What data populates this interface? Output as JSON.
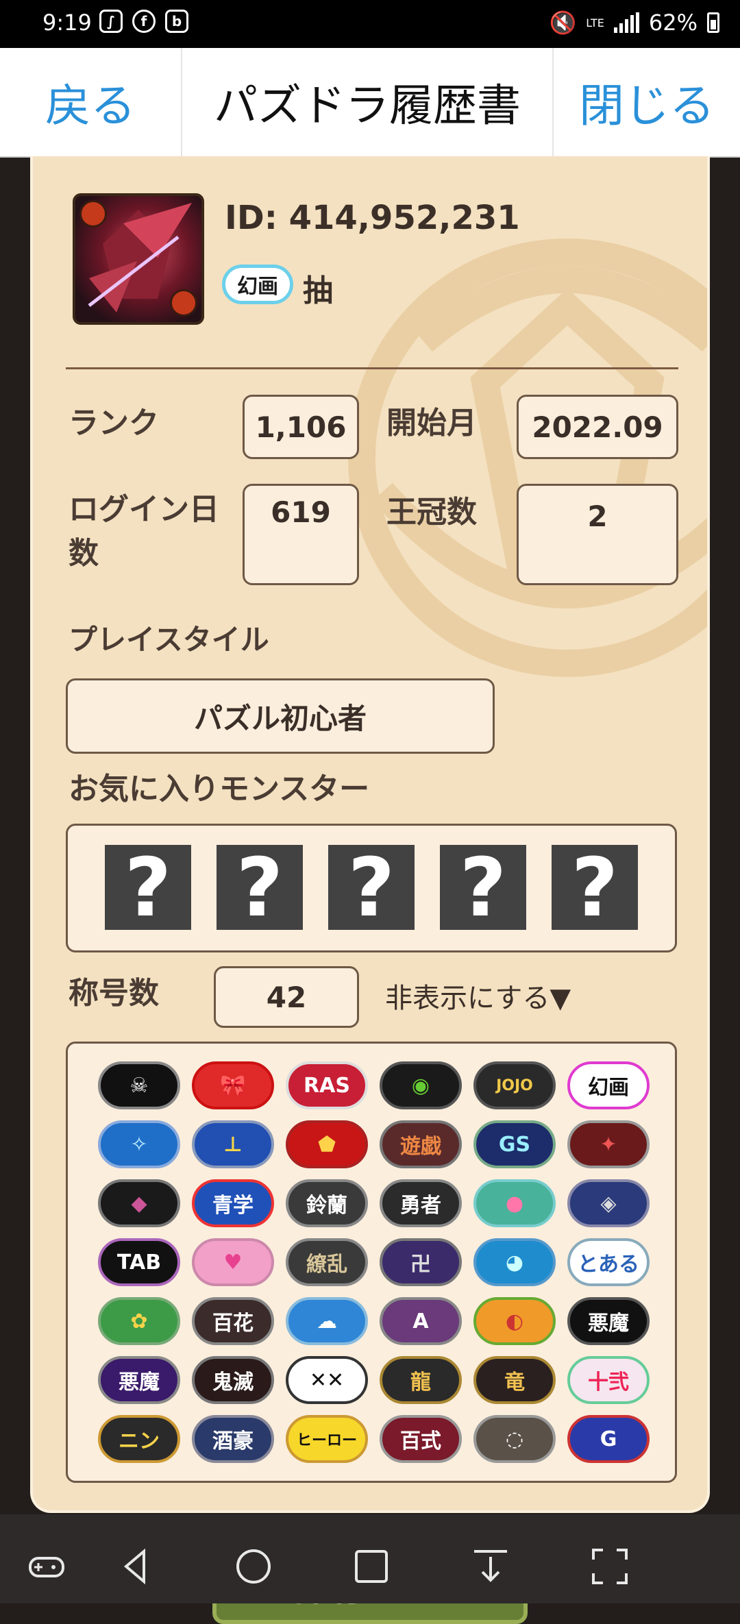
{
  "status": {
    "time": "9:19",
    "network": "LTE",
    "battery": "62%"
  },
  "header": {
    "back": "戻る",
    "title": "パズドラ履歴書",
    "close": "閉じる"
  },
  "profile": {
    "id_text": "ID: 414,952,231",
    "badge": "幻画",
    "name": "抽",
    "rank_label": "ランク",
    "rank": "1,106",
    "start_label": "開始月",
    "start": "2022.09",
    "login_label": "ログイン日\n数",
    "login": "619",
    "crown_label": "王冠数",
    "crown": "2",
    "style_label": "プレイスタイル",
    "style": "パズル初心者",
    "fav_label": "お気に入りモンスター",
    "fav": [
      "?",
      "?",
      "?",
      "?",
      "?"
    ],
    "titles_label": "称号数",
    "titles_count": "42",
    "toggle": "非表示にする▼"
  },
  "badges": [
    {
      "t": "☠",
      "bg": "#111",
      "fg": "#fff",
      "border": "#888"
    },
    {
      "t": "🎀",
      "bg": "#e02a2a",
      "fg": "#fff",
      "border": "#c11"
    },
    {
      "t": "RAS",
      "bg": "#c81f36",
      "fg": "#fff",
      "border": "#ddd"
    },
    {
      "t": "◉",
      "bg": "#1a1a1a",
      "fg": "#6c3",
      "border": "#555"
    },
    {
      "t": "JOJO",
      "bg": "#2a2a2a",
      "fg": "#f0c94a",
      "border": "#555"
    },
    {
      "t": "幻画",
      "bg": "#fff",
      "fg": "#111",
      "border": "#e03ad0"
    },
    {
      "t": "✧",
      "bg": "#1f6fc8",
      "fg": "#bfefff",
      "border": "#8ad"
    },
    {
      "t": "⊥",
      "bg": "#214fb2",
      "fg": "#f3d34a",
      "border": "#89b"
    },
    {
      "t": "⬟",
      "bg": "#c81616",
      "fg": "#ffd24a",
      "border": "#a22"
    },
    {
      "t": "遊戯",
      "bg": "#5a2a2a",
      "fg": "#e84",
      "border": "#777"
    },
    {
      "t": "GS",
      "bg": "#1d2c6b",
      "fg": "#9ef",
      "border": "#7a8"
    },
    {
      "t": "✦",
      "bg": "#6a1a1a",
      "fg": "#e55",
      "border": "#999"
    },
    {
      "t": "◆",
      "bg": "#1a1a1a",
      "fg": "#c59",
      "border": "#777"
    },
    {
      "t": "青学",
      "bg": "#2051b8",
      "fg": "#fff",
      "border": "#e33"
    },
    {
      "t": "鈴蘭",
      "bg": "#3a3a3a",
      "fg": "#fff",
      "border": "#888"
    },
    {
      "t": "勇者",
      "bg": "#2b2b2b",
      "fg": "#fff",
      "border": "#888"
    },
    {
      "t": "●",
      "bg": "#49b29a",
      "fg": "#f7a",
      "border": "#7cc"
    },
    {
      "t": "◈",
      "bg": "#2a3a7a",
      "fg": "#ddd",
      "border": "#88a"
    },
    {
      "t": "TAB",
      "bg": "#111",
      "fg": "#fff",
      "border": "#a6b"
    },
    {
      "t": "♥",
      "bg": "#f3a0c8",
      "fg": "#e7418f",
      "border": "#c8a"
    },
    {
      "t": "繚乱",
      "bg": "#3a3a3a",
      "fg": "#d9c79a",
      "border": "#888"
    },
    {
      "t": "卍",
      "bg": "#3b2b6b",
      "fg": "#ddd",
      "border": "#777"
    },
    {
      "t": "◕",
      "bg": "#1f8ccd",
      "fg": "#cff",
      "border": "#59c"
    },
    {
      "t": "とある",
      "bg": "#fff",
      "fg": "#2a62b8",
      "border": "#8ab"
    },
    {
      "t": "✿",
      "bg": "#3d9b48",
      "fg": "#f7d34a",
      "border": "#7a7"
    },
    {
      "t": "百花",
      "bg": "#3b2b2b",
      "fg": "#fff",
      "border": "#888"
    },
    {
      "t": "☁",
      "bg": "#2f86d6",
      "fg": "#fff",
      "border": "#8bd"
    },
    {
      "t": "A",
      "bg": "#6a3a7a",
      "fg": "#fff",
      "border": "#888"
    },
    {
      "t": "◐",
      "bg": "#f09a2a",
      "fg": "#c33",
      "border": "#6a3"
    },
    {
      "t": "悪魔",
      "bg": "#111",
      "fg": "#fff",
      "border": "#555"
    },
    {
      "t": "悪魔",
      "bg": "#3a1a6a",
      "fg": "#fff",
      "border": "#888"
    },
    {
      "t": "鬼滅",
      "bg": "#2a1a1a",
      "fg": "#fff",
      "border": "#777"
    },
    {
      "t": "✕✕",
      "bg": "#fff",
      "fg": "#111",
      "border": "#333"
    },
    {
      "t": "龍",
      "bg": "#2a2a2a",
      "fg": "#f0c050",
      "border": "#a83"
    },
    {
      "t": "竜",
      "bg": "#2a2020",
      "fg": "#f0c050",
      "border": "#a83"
    },
    {
      "t": "十弐",
      "bg": "#f6e6ef",
      "fg": "#e25",
      "border": "#6c9"
    },
    {
      "t": "ニン",
      "bg": "#2a2a2a",
      "fg": "#f6d24a",
      "border": "#c93"
    },
    {
      "t": "酒豪",
      "bg": "#2a3a6a",
      "fg": "#fff",
      "border": "#889"
    },
    {
      "t": "ヒーロー",
      "bg": "#f7d72a",
      "fg": "#111",
      "border": "#c93"
    },
    {
      "t": "百式",
      "bg": "#7a1a2a",
      "fg": "#fff",
      "border": "#999"
    },
    {
      "t": "◌",
      "bg": "#5a5248",
      "fg": "#fff",
      "border": "#999"
    },
    {
      "t": "G",
      "bg": "#2a3aa8",
      "fg": "#fff",
      "border": "#c33"
    }
  ],
  "save": "保存する"
}
